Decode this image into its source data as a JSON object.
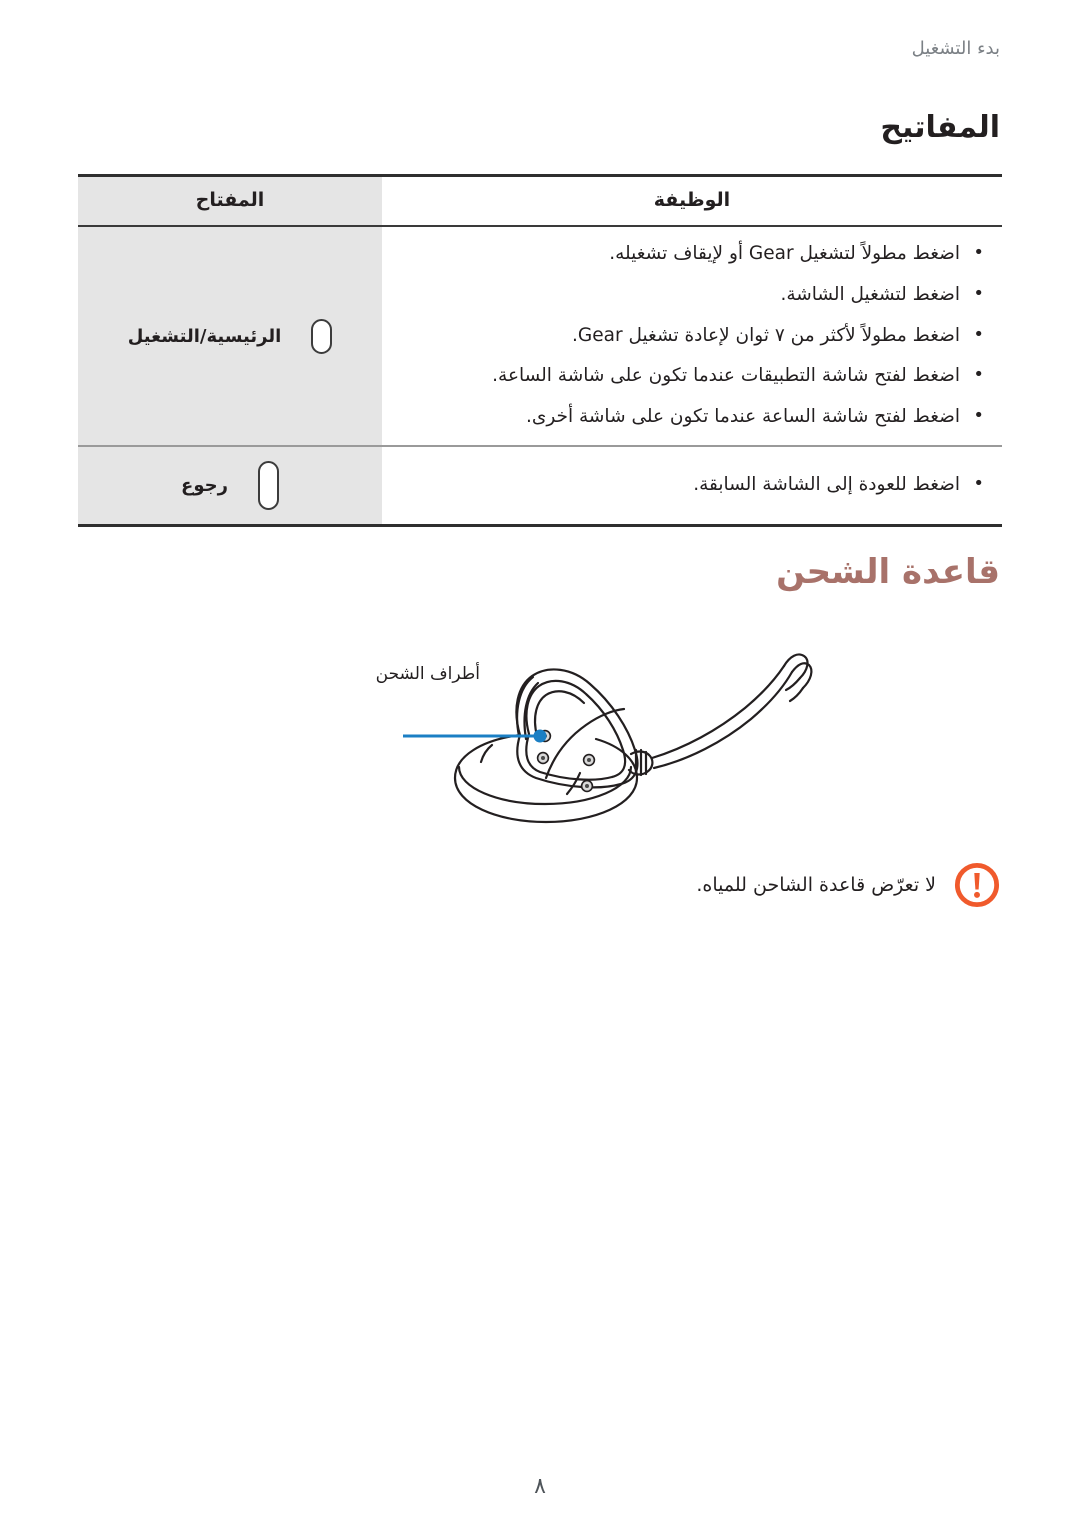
{
  "page": {
    "running_header": "بدء التشغيل",
    "page_number": "٨",
    "background": "#ffffff"
  },
  "keys_section": {
    "title": "المفاتيح",
    "table": {
      "headers": {
        "function": "الوظيفة",
        "key": "المفتاح"
      },
      "rows": [
        {
          "key_label": "الرئيسية/التشغيل",
          "key_icon": "pill-button-small-icon",
          "functions": [
            "اضغط مطولاً لتشغيل Gear أو لإيقاف تشغيله.",
            "اضغط لتشغيل الشاشة.",
            "اضغط مطولاً لأكثر من ٧ ثوان لإعادة تشغيل Gear.",
            "اضغط لفتح شاشة التطبيقات عندما تكون على شاشة الساعة.",
            "اضغط لفتح شاشة الساعة عندما تكون على شاشة أخرى."
          ]
        },
        {
          "key_label": "رجوع",
          "key_icon": "pill-button-tall-icon",
          "functions": [
            "اضغط للعودة إلى الشاشة السابقة."
          ]
        }
      ],
      "colors": {
        "key_column_background": "#e5e5e5",
        "function_column_background": "#ffffff",
        "outer_border": "#2f2f2f",
        "row_separator": "#9a9a9a"
      }
    }
  },
  "dock_section": {
    "heading": "قاعدة الشحن",
    "heading_color": "#a8726a",
    "figure": {
      "name": "charging-dock-illustration",
      "callout_label": "أطراف الشحن",
      "callout_color": "#1b7fc4"
    }
  },
  "warning": {
    "icon": "warning-exclamation-icon",
    "icon_color": "#f05a2c",
    "text": "لا تعرّض قاعدة الشاحن للمياه."
  }
}
